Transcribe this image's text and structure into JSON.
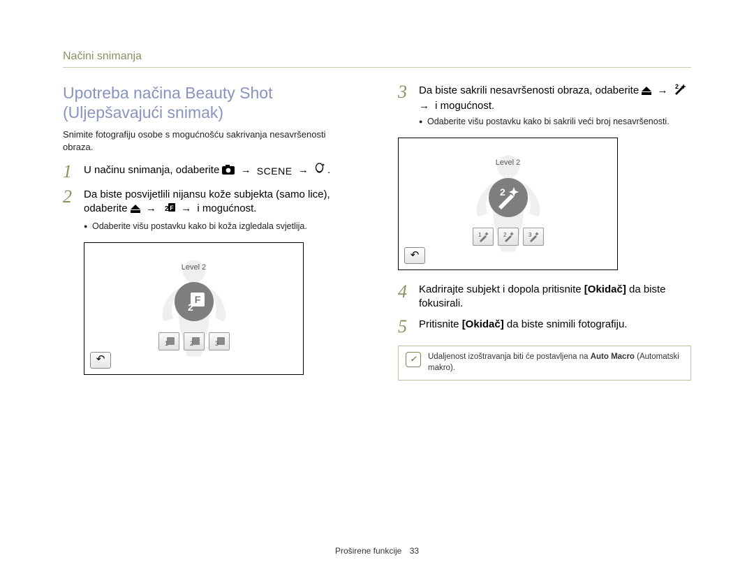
{
  "header": "Načini snimanja",
  "footer": {
    "label": "Proširene funkcije",
    "page": "33"
  },
  "left": {
    "title": "Upotreba načina Beauty Shot (Uljepšavajući snimak)",
    "intro": "Snimite fotografiju osobe s mogućnošću sakrivanja nesavršenosti obraza.",
    "step1_a": "U načinu snimanja, odaberite ",
    "step1_b": ".",
    "step2_a": "Da biste posvijetlili nijansu kože subjekta (samo lice), odaberite ",
    "step2_b": " i mogućnost.",
    "step2_sub": "Odaberite višu postavku kako bi koža izgledala svjetlija.",
    "diagram": {
      "level_label": "Level 2",
      "opts": [
        "1",
        "2",
        "3"
      ],
      "center_glyph": "F₂"
    }
  },
  "right": {
    "step3_a": "Da biste sakrili nesavršenosti obraza, odaberite ",
    "step3_b": " i mogućnost.",
    "step3_sub": "Odaberite višu postavku kako bi sakrili veći broj nesavršenosti.",
    "diagram": {
      "level_label": "Level 2",
      "opts": [
        "1",
        "2",
        "3"
      ],
      "center_glyph": "✦₂"
    },
    "step4_a": "Kadrirajte subjekt i dopola pritisnite ",
    "step4_b": "[Okidač]",
    "step4_c": " da biste fokusirali.",
    "step5_a": "Pritisnite ",
    "step5_b": "[Okidač]",
    "step5_c": " da biste snimili fotografiju.",
    "note_a": "Udaljenost izoštravanja biti će postavljena na ",
    "note_b": "Auto Macro",
    "note_c": " (Automatski makro)."
  },
  "icons": {
    "menu": "menu-icon",
    "camera": "camera-mode-icon",
    "scene": "SCENE",
    "beauty": "beauty-shot-icon",
    "up": "▲",
    "arrow": "→",
    "face_tone": "face-tone-icon",
    "retouch": "retouch-icon",
    "back": "↶"
  }
}
